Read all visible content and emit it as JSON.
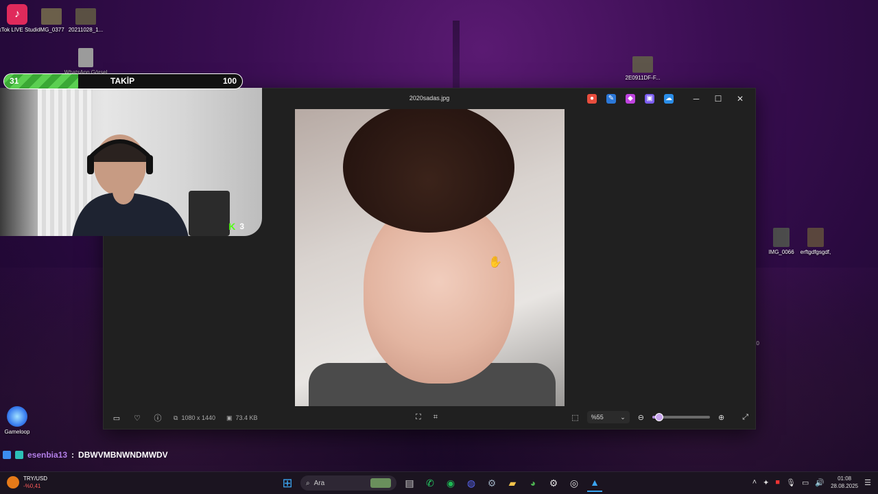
{
  "desktop": {
    "icons": [
      {
        "name": "tiktok-live-studio",
        "label": "TikTok LIVE Studio",
        "color": "#e02a5b"
      },
      {
        "name": "img-0377",
        "label": "IMG_0377",
        "color": "#6b5f4a"
      },
      {
        "name": "img-20211028",
        "label": "20211028_1...",
        "color": "#5a5043"
      },
      {
        "name": "whatsapp-gorsel",
        "label": "WhatsApp Görsel 2025...",
        "color": "#9b9b9b"
      },
      {
        "name": "img-2e0911df",
        "label": "2E0911DF-F...",
        "color": "#5e564b"
      },
      {
        "name": "img-0066",
        "label": "IMG_0066",
        "color": "#4c4c4c"
      },
      {
        "name": "erftgdfgsgdf",
        "label": "erftgdfgsgdf,",
        "color": "#5a463d"
      },
      {
        "name": "gameloop",
        "label": "Gameloop",
        "color": "#3a7ef0"
      }
    ],
    "stray_text": "20"
  },
  "follow_goal": {
    "current": "31",
    "label": "TAKİP",
    "goal": "100",
    "progress": 0.31
  },
  "webcam": {
    "kick_label": "3"
  },
  "viewer": {
    "title": "2020sadas.jpg",
    "dimensions": "1080 x 1440",
    "filesize": "73.4 KB",
    "zoom": "%55",
    "zoom_level": 0.55
  },
  "chat": {
    "user": "esenbia13",
    "separator": ":",
    "message": "DBWVMBNWNDMWDV"
  },
  "taskbar": {
    "stock_symbol": "TRY/USD",
    "stock_change": "-%0,41",
    "search_placeholder": "Ara",
    "time": "01:08",
    "date": "28.08.2025"
  }
}
